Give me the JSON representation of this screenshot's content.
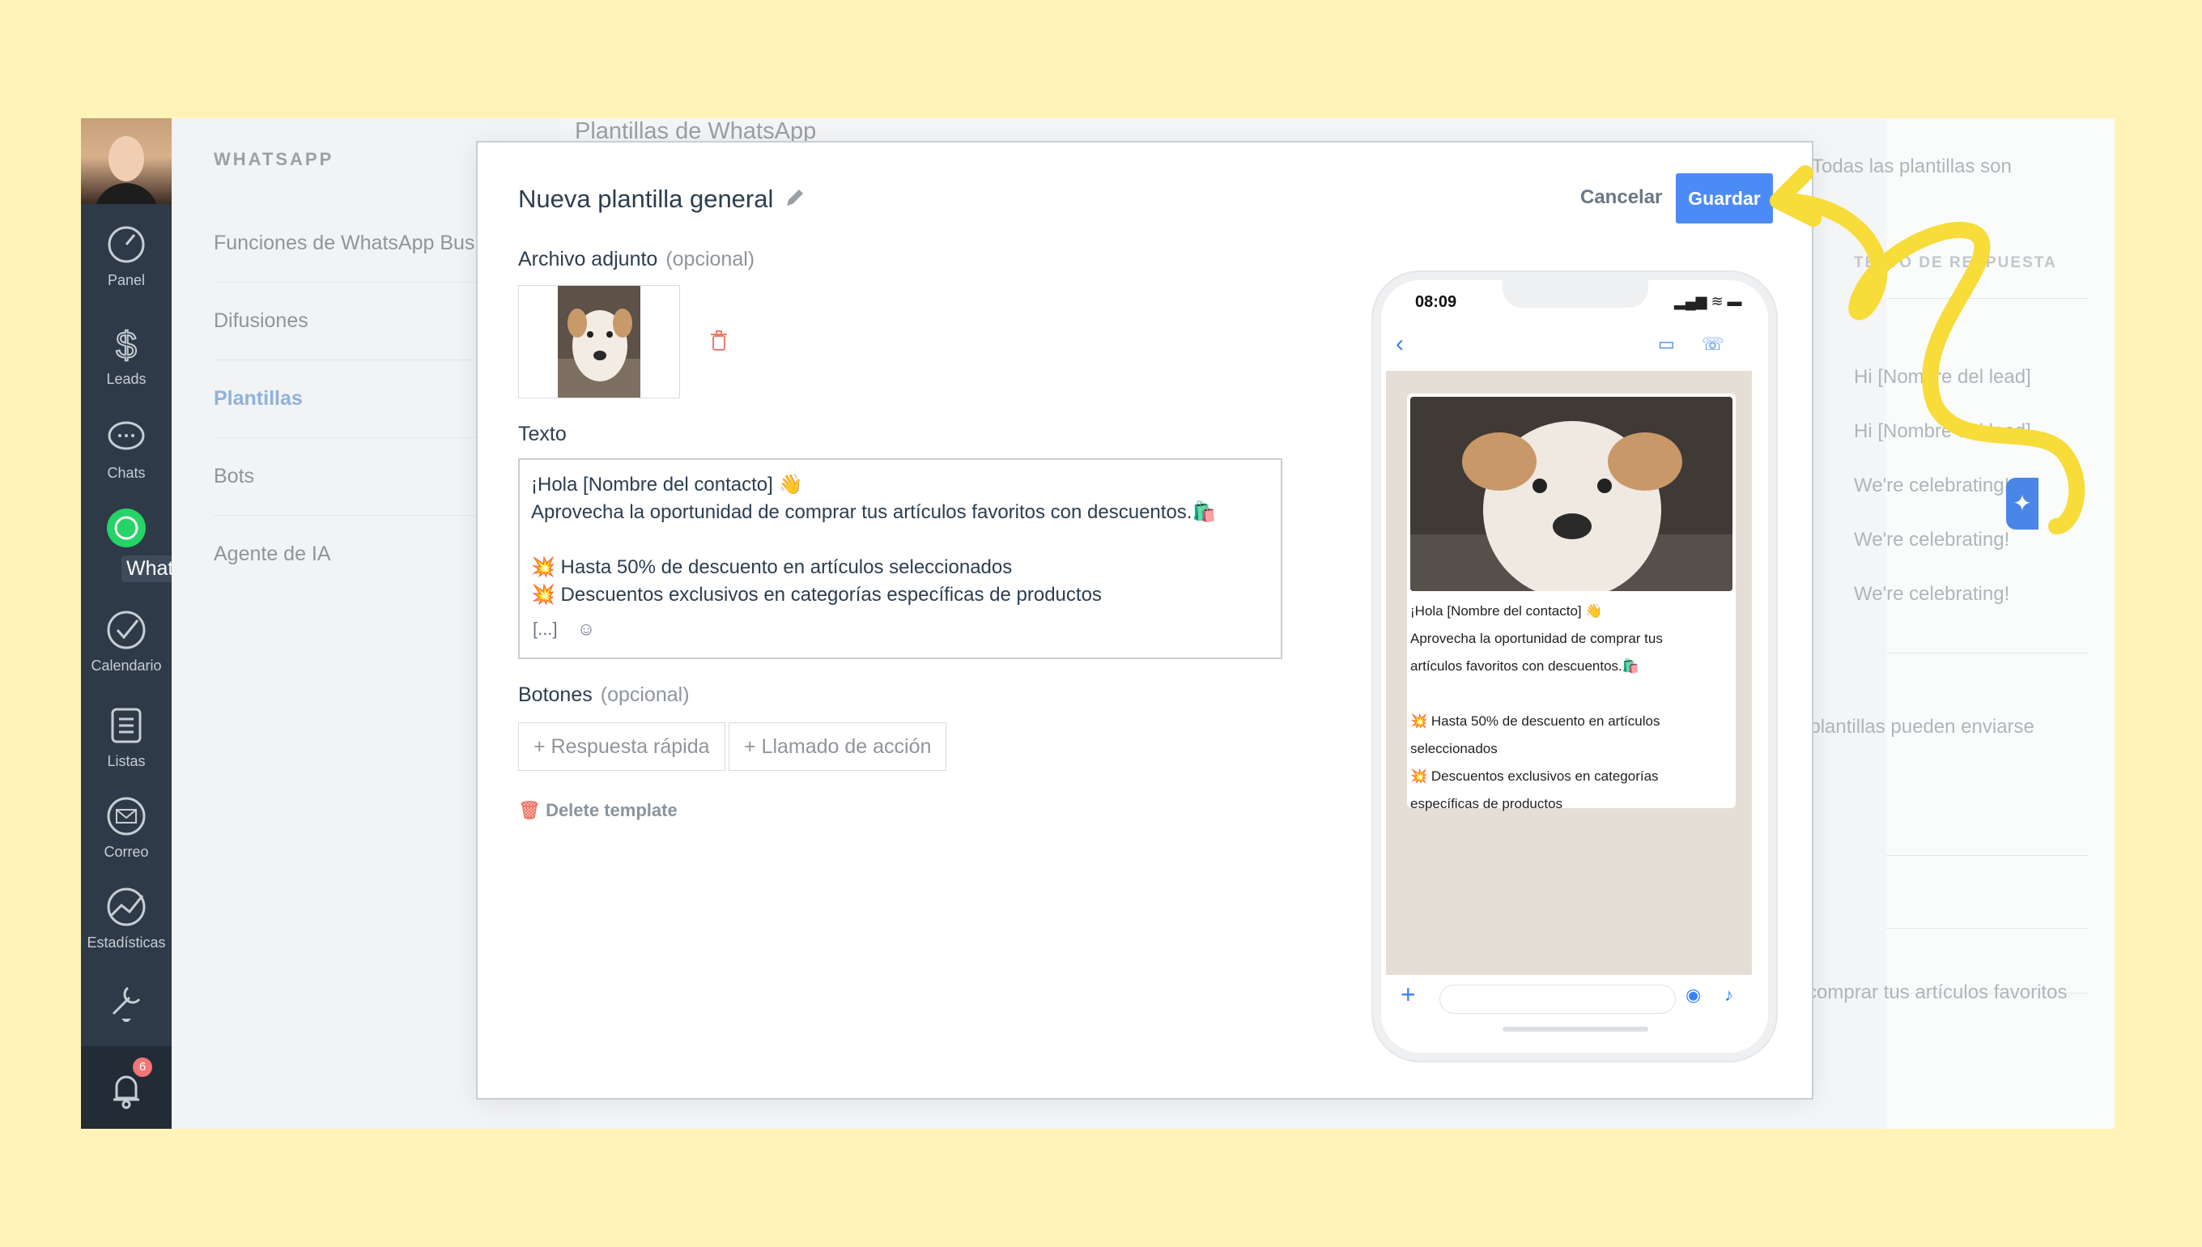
{
  "nav": {
    "items": [
      {
        "label": "Panel",
        "icon": "gauge-icon"
      },
      {
        "label": "Leads",
        "icon": "dollar-icon"
      },
      {
        "label": "Chats",
        "icon": "chat-icon"
      },
      {
        "label": "WhatsApp",
        "icon": "whatsapp-icon"
      },
      {
        "label": "Calendario",
        "icon": "check-circle-icon"
      },
      {
        "label": "Listas",
        "icon": "list-icon"
      },
      {
        "label": "Correo",
        "icon": "mail-icon"
      },
      {
        "label": "Estadísticas",
        "icon": "stats-icon"
      },
      {
        "label": "",
        "icon": "settings-icon"
      }
    ],
    "notifications": "6"
  },
  "sidebar": {
    "title": "WHATSAPP",
    "items": [
      "Funciones de WhatsApp Business",
      "Difusiones",
      "Plantillas",
      "Bots",
      "Agente de IA"
    ],
    "active": "Plantillas"
  },
  "background": {
    "title": "Plantillas de WhatsApp",
    "note1": "Todas las plantillas son",
    "column": "TEXTO DE RESPUESTA",
    "rows": [
      "Hi [Nombre del lead]",
      "Hi [Nombre del lead]",
      "We're celebrating!",
      "We're celebrating!",
      "We're celebrating!"
    ],
    "note2": "Las plantillas pueden enviarse",
    "row_last": "comprar tus artículos favoritos"
  },
  "modal": {
    "title": "Nueva plantilla general",
    "cancel": "Cancelar",
    "save": "Guardar",
    "attachment_label": "Archivo adjunto",
    "optional": "(opcional)",
    "text_label": "Texto",
    "text_lines": [
      "¡Hola [Nombre del contacto] 👋",
      "Aprovecha la oportunidad de comprar tus artículos favoritos con descuentos.🛍️",
      "",
      "💥 Hasta 50% de descuento en artículos seleccionados",
      "💥 Descuentos exclusivos en categorías específicas de productos"
    ],
    "text_tools": [
      "[...]",
      "sticker-icon"
    ],
    "buttons_label": "Botones",
    "quick_reply": "+ Respuesta rápida",
    "call_to_action": "+ Llamado de acción",
    "delete": "Delete template"
  },
  "phone": {
    "time": "08:09",
    "message_lines": [
      "¡Hola [Nombre del contacto] 👋",
      "Aprovecha la oportunidad de comprar tus",
      "artículos favoritos con descuentos.🛍️",
      "",
      "💥 Hasta 50% de descuento en artículos",
      "seleccionados",
      "💥 Descuentos exclusivos en categorías",
      "específicas de productos"
    ]
  },
  "colors": {
    "accent": "#4c8bf5",
    "rail": "#2e3a47",
    "whatsapp": "#25d366",
    "annotation": "#f7dc3a",
    "backdrop": "#fff3b8"
  }
}
